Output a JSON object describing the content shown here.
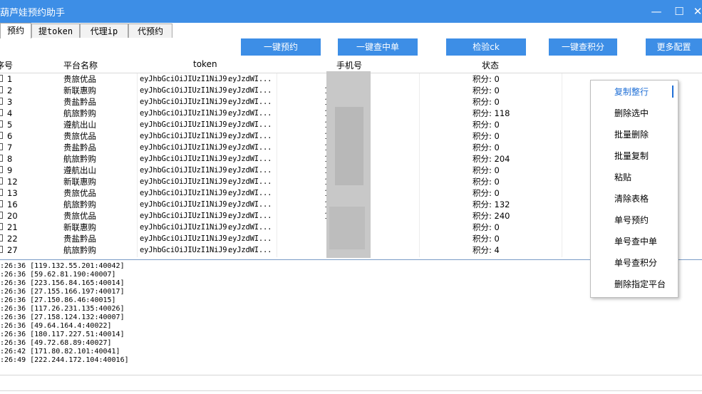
{
  "window": {
    "title": "葫芦娃预约助手",
    "minimize_glyph": "—",
    "maximize_glyph": "☐",
    "close_glyph": "✕"
  },
  "tabs": [
    {
      "label": "预约",
      "active": true
    },
    {
      "label": "提token",
      "active": false
    },
    {
      "label": "代理ip",
      "active": false
    },
    {
      "label": "代预约",
      "active": false
    }
  ],
  "toolbar": {
    "btn1": "一键预约",
    "btn2": "一键查中单",
    "btn3": "检验ck",
    "btn4": "一键查积分",
    "btn5": "更多配置"
  },
  "grid": {
    "headers": {
      "num": "序号",
      "platform": "平台名称",
      "token": "token",
      "phone": "手机号",
      "status": "状态"
    },
    "rows": [
      {
        "num": "1",
        "platform": "贵旅优品",
        "tok1": "eyJhbGciOiJIUzI1NiJ9.",
        "tok2": "eyJzdWI...",
        "ph1": "",
        "ph2": "5",
        "status": "积分: 0"
      },
      {
        "num": "2",
        "platform": "新联惠购",
        "tok1": "eyJhbGciOiJIUzI1NiJ9.",
        "tok2": "eyJzdWI...",
        "ph1": "1",
        "ph2": "",
        "status": "积分: 0"
      },
      {
        "num": "3",
        "platform": "贵盐黔品",
        "tok1": "eyJhbGciOiJIUzI1NiJ9.",
        "tok2": "eyJzdWI...",
        "ph1": "1",
        "ph2": "5",
        "status": "积分: 0"
      },
      {
        "num": "4",
        "platform": "航旅黔购",
        "tok1": "eyJhbGciOiJIUzI1NiJ9.",
        "tok2": "eyJzdWI...",
        "ph1": "1",
        "ph2": "5",
        "status": "积分: 118"
      },
      {
        "num": "5",
        "platform": "遵航出山",
        "tok1": "eyJhbGciOiJIUzI1NiJ9.",
        "tok2": "eyJzdWI...",
        "ph1": "1",
        "ph2": "",
        "status": "积分: 0"
      },
      {
        "num": "6",
        "platform": "贵旅优品",
        "tok1": "eyJhbGciOiJIUzI1NiJ9.",
        "tok2": "eyJzdWI...",
        "ph1": "1",
        "ph2": "",
        "status": "积分: 0"
      },
      {
        "num": "7",
        "platform": "贵盐黔品",
        "tok1": "eyJhbGciOiJIUzI1NiJ9.",
        "tok2": "eyJzdWI...",
        "ph1": "1",
        "ph2": "2",
        "status": "积分: 0"
      },
      {
        "num": "8",
        "platform": "航旅黔购",
        "tok1": "eyJhbGciOiJIUzI1NiJ9.",
        "tok2": "eyJzdWI...",
        "ph1": "1",
        "ph2": "6",
        "status": "积分: 204"
      },
      {
        "num": "9",
        "platform": "遵航出山",
        "tok1": "eyJhbGciOiJIUzI1NiJ9.",
        "tok2": "eyJzdWI...",
        "ph1": "1",
        "ph2": "",
        "status": "积分: 0"
      },
      {
        "num": "12",
        "platform": "新联惠购",
        "tok1": "eyJhbGciOiJIUzI1NiJ9.",
        "tok2": "eyJzdWI...",
        "ph1": "1",
        "ph2": "",
        "status": "积分: 0"
      },
      {
        "num": "13",
        "platform": "贵旅优品",
        "tok1": "eyJhbGciOiJIUzI1NiJ9.",
        "tok2": "eyJzdWI...",
        "ph1": "1",
        "ph2": "",
        "status": "积分: 0"
      },
      {
        "num": "16",
        "platform": "航旅黔购",
        "tok1": "eyJhbGciOiJIUzI1NiJ9.",
        "tok2": "eyJzdWI...",
        "ph1": "1",
        "ph2": "",
        "status": "积分: 132"
      },
      {
        "num": "20",
        "platform": "贵旅优品",
        "tok1": "eyJhbGciOiJIUzI1NiJ9.",
        "tok2": "eyJzdWI...",
        "ph1": "1",
        "ph2": "",
        "status": "积分: 240"
      },
      {
        "num": "21",
        "platform": "新联惠购",
        "tok1": "eyJhbGciOiJIUzI1NiJ9.",
        "tok2": "eyJzdWI...",
        "ph1": "",
        "ph2": "5",
        "status": "积分: 0"
      },
      {
        "num": "22",
        "platform": "贵盐黔品",
        "tok1": "eyJhbGciOiJIUzI1NiJ9.",
        "tok2": "eyJzdWI...",
        "ph1": "",
        "ph2": "5",
        "status": "积分: 0"
      },
      {
        "num": "27",
        "platform": "航旅黔购",
        "tok1": "eyJhbGciOiJIUzI1NiJ9.",
        "tok2": "eyJzdWI...",
        "ph1": "",
        "ph2": "1",
        "status": "积分: 4"
      }
    ]
  },
  "log": [
    ":26:36 [119.132.55.201:40042]",
    ":26:36 [59.62.81.190:40007]",
    ":26:36 [223.156.84.165:40014]",
    ":26:36 [27.155.166.197:40017]",
    ":26:36 [27.150.86.46:40015]",
    ":26:36 [117.26.231.135:40026]",
    ":26:36 [27.158.124.132:40007]",
    ":26:36 [49.64.164.4:40022]",
    ":26:36 [180.117.227.51:40014]",
    ":26:36 [49.72.68.89:40027]",
    ":26:42 [171.80.82.101:40041]",
    ":26:49 [222.244.172.104:40016]"
  ],
  "context_menu": [
    "复制整行",
    "删除选中",
    "批量删除",
    "批量复制",
    "粘贴",
    "清除表格",
    "单号预约",
    "单号查中单",
    "单号查积分",
    "删除指定平台"
  ]
}
